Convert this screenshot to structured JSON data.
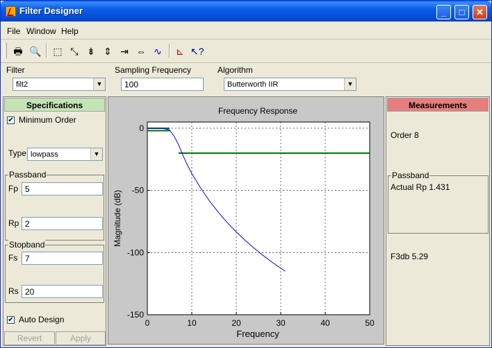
{
  "window": {
    "title": "Filter Designer"
  },
  "menu": [
    "File",
    "Window",
    "Help"
  ],
  "toolbar": {
    "icons": [
      "print-icon",
      "print-preview-icon",
      "zoom-box-icon",
      "zoom-fit-icon",
      "zoom-y-in-icon",
      "zoom-y-out-icon",
      "zoom-x-in-icon",
      "zoom-x-out-icon",
      "full-view-icon",
      "filter-response-icon",
      "context-help-icon"
    ]
  },
  "controls": {
    "filter_label": "Filter",
    "filter_value": "filt2",
    "fs_label": "Sampling Frequency",
    "fs_value": "100",
    "algorithm_label": "Algorithm",
    "algorithm_value": "Butterworth IIR"
  },
  "specs": {
    "header": "Specifications",
    "minimum_order_label": "Minimum Order",
    "minimum_order_checked": true,
    "type_label": "Type",
    "type_value": "lowpass",
    "passband_title": "Passband",
    "fp_label": "Fp",
    "fp_value": "5",
    "rp_label": "Rp",
    "rp_value": "2",
    "stopband_title": "Stopband",
    "fs_label": "Fs",
    "fs_value": "7",
    "rs_label": "Rs",
    "rs_value": "20",
    "auto_design_label": "Auto Design",
    "auto_design_checked": true,
    "revert_label": "Revert",
    "apply_label": "Apply"
  },
  "measurements": {
    "header": "Measurements",
    "order_text": "Order 8",
    "passband_title": "Passband",
    "actual_rp_text": "Actual Rp 1.431",
    "f3db_text": "F3db 5.29"
  },
  "colors": {
    "specs_header": "#c5e3b7",
    "meas_header": "#e67e7e",
    "response": "#0000ff",
    "spec_lines": "#007000"
  },
  "chart_data": {
    "type": "line",
    "title": "Frequency Response",
    "xlabel": "Frequency",
    "ylabel": "Magnitude (dB)",
    "xlim": [
      0,
      50
    ],
    "ylim": [
      -150,
      5
    ],
    "xticks": [
      "0",
      "10",
      "20",
      "30",
      "40",
      "50"
    ],
    "yticks": [
      "0",
      "-50",
      "-100",
      "-150"
    ],
    "grid": true,
    "series": [
      {
        "x": [
          0,
          2,
          3,
          4,
          5,
          5.3,
          6,
          7,
          8,
          9,
          10,
          12,
          14,
          16,
          18,
          20,
          22,
          24,
          26,
          28,
          30,
          31
        ],
        "y": [
          0,
          0,
          -0.1,
          -0.5,
          -1.4,
          -3,
          -6.3,
          -13,
          -21.7,
          -29.5,
          -36.5,
          -48.2,
          -58.6,
          -67.8,
          -76,
          -83.4,
          -90.2,
          -96.4,
          -102.2,
          -107.6,
          -112.6,
          -115
        ]
      }
    ],
    "spec_lines": {
      "passband": {
        "x": [
          0,
          5
        ],
        "y_upper": 0,
        "y_lower": -2
      },
      "stopband": {
        "x": [
          7,
          50
        ],
        "y": -20
      }
    }
  }
}
